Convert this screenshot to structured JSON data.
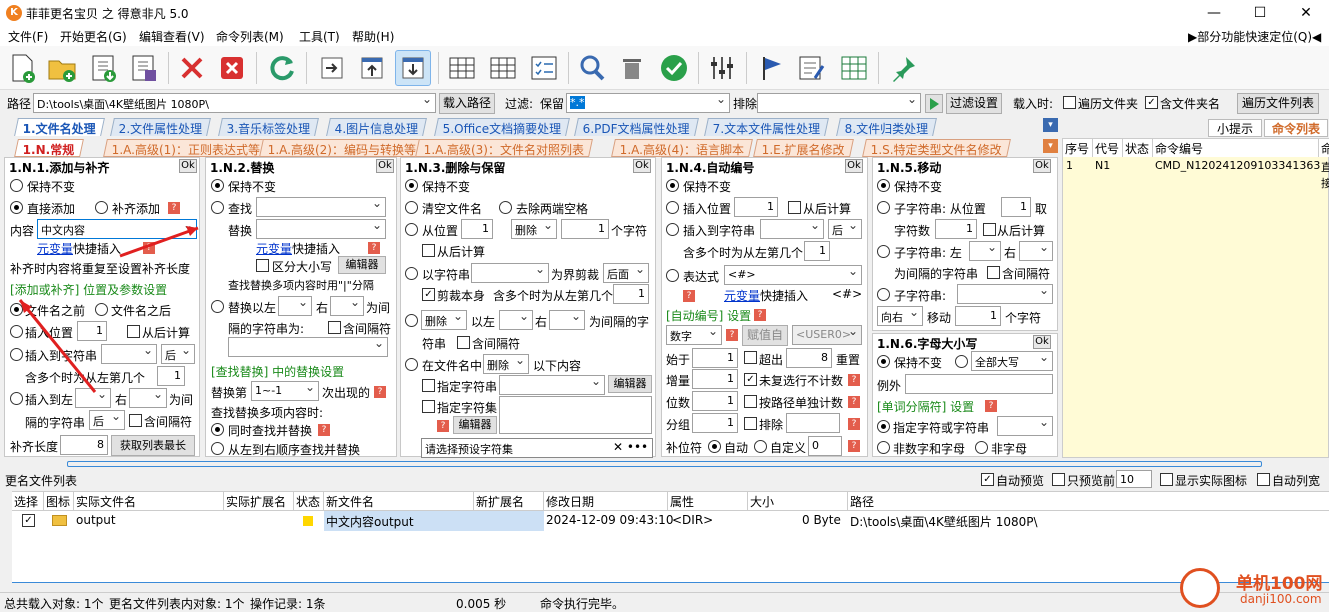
{
  "window": {
    "title": "菲菲更名宝贝 之 得意非凡 5.0",
    "min": "—",
    "max": "☐",
    "close": "✕"
  },
  "menu": {
    "items": [
      "文件(F)",
      "开始更名(G)",
      "编辑查看(V)",
      "命令列表(M)",
      "工具(T)",
      "帮助(H)"
    ],
    "quick": "▶部分功能快速定位(Q)◀"
  },
  "pathbar": {
    "label": "路径",
    "value": "D:\\tools\\桌面\\4K壁纸图片 1080P\\",
    "load_btn": "载入路径",
    "filter_label": "过滤:",
    "keep_label": "保留",
    "keep_value": "*.*",
    "exclude_label": "排除",
    "filter_btn": "过滤设置",
    "load_when": "载入时:",
    "opt1": "遍历文件夹",
    "opt2": "含文件夹名",
    "traverse_btn": "遍历文件列表"
  },
  "tabs1": [
    "1.文件名处理",
    "2.文件属性处理",
    "3.音乐标签处理",
    "4.图片信息处理",
    "5.Office文档摘要处理",
    "6.PDF文档属性处理",
    "7.文本文件属性处理",
    "8.文件归类处理"
  ],
  "tabs2": [
    "1.N.常规",
    "1.A.高级(1)：正则表达式等",
    "1.A.高级(2)：编码与转换等",
    "1.A.高级(3)：文件名对照列表",
    "1.A.高级(4)：语言脚本",
    "1.E.扩展名修改",
    "1.S.特定类型文件名修改"
  ],
  "right_tabs": {
    "hint": "小提示",
    "cmd": "命令列表"
  },
  "cmd_table": {
    "headers": [
      "序号",
      "代号",
      "状态",
      "命令编号",
      "命令"
    ],
    "row": [
      "1",
      "N1",
      "",
      "CMD_N120241209103341363",
      "直接"
    ]
  },
  "p1": {
    "title": "1.N.1.添加与补齐",
    "ok": "Ok",
    "opt_keep": "保持不变",
    "opt_direct": "直接添加",
    "opt_pad": "补齐添加",
    "content_label": "内容",
    "content_value": "中文内容",
    "var_link": "元变量",
    "quick_insert": "快捷插入",
    "note": "补齐时内容将重复至设置补齐长度",
    "group_title": "[添加或补齐] 位置及参数设置",
    "opt_before": "文件名之前",
    "opt_after": "文件名之后",
    "opt_insert_pos": "插入位置",
    "pos_val": "1",
    "from_end": "从后计算",
    "opt_insert_str": "插入到字符串",
    "after": "后",
    "multi_left": "含多个时为从左第几个",
    "multi_val": "1",
    "opt_insert_lr": "插入到左",
    "right": "右",
    "between": "为间",
    "sep_label": "隔的字符串",
    "sep_val": "后",
    "include_sep": "含间隔符",
    "pad_len_label": "补齐长度",
    "pad_len_val": "8",
    "get_max_btn": "获取列表最长"
  },
  "p2": {
    "title": "1.N.2.替换",
    "ok": "Ok",
    "opt_keep": "保持不变",
    "opt_find": "查找",
    "replace_label": "替换",
    "var_link": "元变量",
    "quick_insert": "快捷插入",
    "case_label": "区分大小写",
    "editor_btn": "编辑器",
    "note": "查找替换多项内容时用\"|\"分隔",
    "opt_repl_lr": "替换以左",
    "right": "右",
    "between": "为间",
    "sep_label": "隔的字符串为:",
    "include_sep": "含间隔符",
    "group_title": "[查找替换] 中的替换设置",
    "repl_count_label": "替换第",
    "repl_count_val": "1~-1",
    "occur_label": "次出现的",
    "multi_note": "查找替换多项内容时:",
    "opt_sim": "同时查找并替换",
    "opt_lr": "从左到右顺序查找并替换"
  },
  "p3": {
    "title": "1.N.3.删除与保留",
    "ok": "Ok",
    "opt_keep": "保持不变",
    "opt_clear": "清空文件名",
    "opt_trim": "去除两端空格",
    "opt_from": "从位置",
    "from_val": "1",
    "del_label": "删除",
    "n_val": "1",
    "chars": "个字符",
    "from_end": "从后计算",
    "opt_str": "以字符串",
    "cut_label": "为界剪裁",
    "cut_val": "后面",
    "cut_self": "剪裁本身",
    "multi_left": "含多个时为从左第几个",
    "multi_val": "1",
    "opt_del": "删除",
    "to_left": "以左",
    "right": "右",
    "between_str": "为间隔的字",
    "str_label": "符串",
    "include_sep": "含间隔符",
    "opt_in_name": "在文件名中",
    "del2": "删除",
    "content_below": "以下内容",
    "specify_str": "指定字符串",
    "editor_btn": "编辑器",
    "specify_set": "指定字符集",
    "editor_btn2": "编辑器",
    "preset_placeholder": "请选择预设字符集"
  },
  "p4": {
    "title": "1.N.4.自动编号",
    "ok": "Ok",
    "opt_keep": "保持不变",
    "opt_insert_pos": "插入位置",
    "pos_val": "1",
    "from_end": "从后计算",
    "opt_insert_str": "插入到字符串",
    "after": "后",
    "multi_left": "含多个时为从左第几个",
    "multi_val": "1",
    "opt_expr": "表达式",
    "expr_val": "<#>",
    "var_link": "元变量",
    "quick_insert": "快捷插入",
    "hash": "<#>",
    "group_title": "[自动编号] 设置",
    "type_val": "数字",
    "assign_btn": "赋值自",
    "user_val": "<USER0>",
    "start_label": "始于",
    "start_val": "1",
    "exceed_label": "超出",
    "exceed_val": "8",
    "reset_label": "重置",
    "step_label": "增量",
    "step_val": "1",
    "skip_label": "未复选行不计数",
    "digits_label": "位数",
    "digits_val": "1",
    "by_path_label": "按路径单独计数",
    "group_label": "分组",
    "group_val": "1",
    "exclude_label": "排除",
    "pad_label": "补位符",
    "opt_auto": "自动",
    "opt_custom": "自定义",
    "custom_val": "0"
  },
  "p5": {
    "title": "1.N.5.移动",
    "ok": "Ok",
    "opt_keep": "保持不变",
    "opt_sub1": "子字符串: 从位置",
    "sub1_val": "1",
    "take": "取",
    "char_count": "字符数",
    "char_val": "1",
    "from_end": "从后计算",
    "opt_sub2": "子字符串: 左",
    "right": "右",
    "between_str": "为间隔的字符串",
    "include_sep": "含间隔符",
    "opt_sub3": "子字符串:",
    "dir_val": "向右",
    "move_label": "移动",
    "move_val": "1",
    "chars": "个字符"
  },
  "p6": {
    "title": "1.N.6.字母大小写",
    "ok": "Ok",
    "opt_keep": "保持不变",
    "case_val": "全部大写",
    "except_label": "例外",
    "group_title": "[单词分隔符] 设置",
    "opt_specify": "指定字符或字符串",
    "opt_non_alnum": "非数字和字母",
    "opt_non_letter": "非字母"
  },
  "filelist": {
    "title": "更名文件列表",
    "auto_preview": "自动预览",
    "preview_only": "只预览前",
    "preview_n": "10",
    "show_icon": "显示实际图标",
    "auto_width": "自动列宽",
    "headers": [
      "选择",
      "图标",
      "实际文件名",
      "实际扩展名",
      "状态",
      "新文件名",
      "新扩展名",
      "修改日期",
      "属性",
      "大小",
      "路径"
    ],
    "rows": [
      {
        "name": "output",
        "ext": "",
        "new_name": "中文内容output",
        "new_ext": "",
        "date": "2024-12-09 09:43:10",
        "attr": "<DIR>",
        "size": "0 Byte",
        "path": "D:\\tools\\桌面\\4K壁纸图片 1080P\\"
      }
    ]
  },
  "status": {
    "total": "总共载入对象: 1个",
    "list": "更名文件列表内对象: 1个",
    "ops": "操作记录: 1条",
    "time": "0.005 秒",
    "msg": "命令执行完毕。"
  },
  "watermark": {
    "text": "单机100网",
    "url": "danji100.com"
  },
  "colors": {
    "accent": "#0078d7",
    "tab_blue": "#1a56b6",
    "tab_orange": "#d06a2a",
    "red": "#d02020",
    "green": "#1a8a1a",
    "yellow_panel": "#fffbd6"
  }
}
